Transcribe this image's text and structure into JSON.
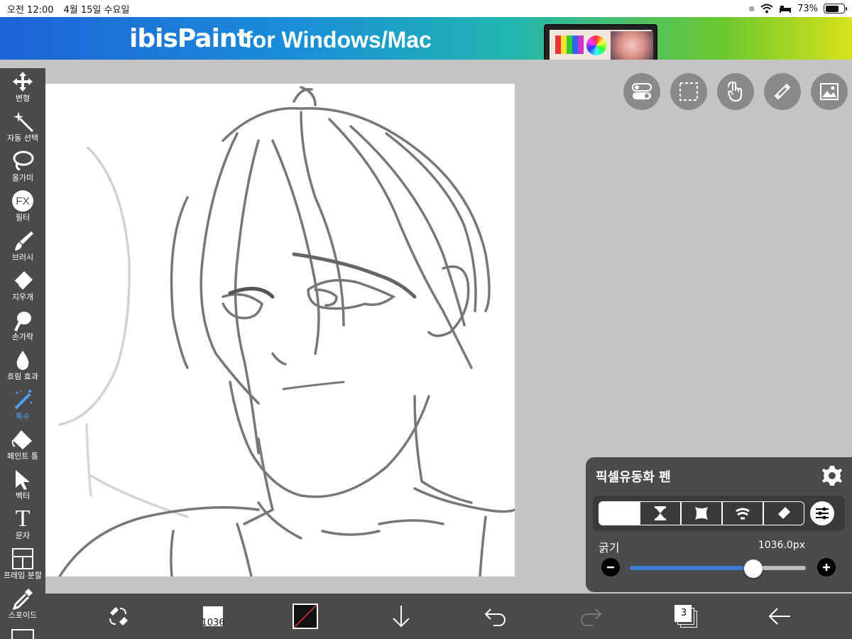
{
  "status_bar": {
    "time": "오전 12:00",
    "date": "4월 15일 수요일",
    "battery": "73%",
    "battery_level": 0.73
  },
  "banner": {
    "brand": "ibisPaint",
    "tagline": "for Windows/Mac"
  },
  "tools": [
    {
      "label": "변형",
      "icon": "move-icon"
    },
    {
      "label": "자동 선택",
      "icon": "magic-wand-icon"
    },
    {
      "label": "올가미",
      "icon": "lasso-icon"
    },
    {
      "label": "필터",
      "icon": "fx-icon",
      "icon_text": "FX"
    },
    {
      "label": "브러시",
      "icon": "brush-icon"
    },
    {
      "label": "지우개",
      "icon": "eraser-icon"
    },
    {
      "label": "손가락",
      "icon": "finger-icon"
    },
    {
      "label": "흐림 효과",
      "icon": "blur-icon"
    },
    {
      "label": "특수",
      "icon": "special-icon",
      "active": true
    },
    {
      "label": "페인트 통",
      "icon": "paint-bucket-icon"
    },
    {
      "label": "벡터",
      "icon": "vector-icon"
    },
    {
      "label": "문자",
      "icon": "text-icon",
      "icon_text": "T"
    },
    {
      "label": "프레임 분할",
      "icon": "frame-divide-icon"
    },
    {
      "label": "스포이드",
      "icon": "eyedropper-icon"
    }
  ],
  "top_buttons": [
    "toggle-icon",
    "selection-icon",
    "touch-icon",
    "ruler-icon",
    "image-icon"
  ],
  "brush_panel": {
    "title": "픽셀유동화 펜",
    "modes": [
      "moon-icon",
      "hourglass-icon",
      "pinch-icon",
      "wave-icon",
      "eraser-icon"
    ],
    "selected_mode": 0,
    "size_label": "굵기",
    "size_value": "1036.0px",
    "slider_fraction": 0.7
  },
  "bottom_bar": {
    "brush_size": "1036",
    "layer_count": "3"
  },
  "colors": {
    "toolbar": "#4a4a4a",
    "accent": "#3f78d1",
    "active_tool": "#4ea3ff"
  }
}
